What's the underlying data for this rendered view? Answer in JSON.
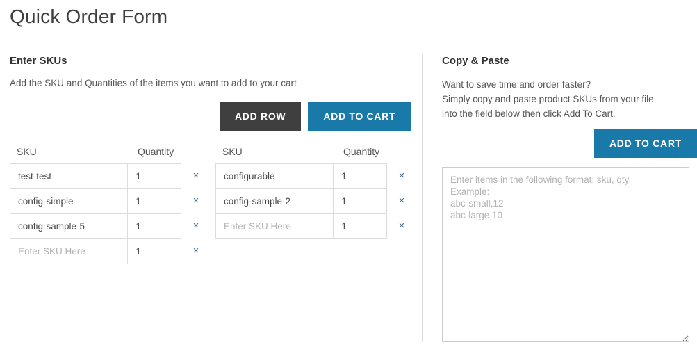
{
  "page": {
    "title": "Quick Order Form"
  },
  "colors": {
    "accent_blue": "#1979a9",
    "dark_button": "#403f3f",
    "remove_icon": "#4a6e8a",
    "border": "#dcdcdc",
    "placeholder": "#b3b3b3"
  },
  "enter_skus": {
    "heading": "Enter SKUs",
    "description": "Add the SKU and Quantities of the items you want to add to your cart",
    "add_row_label": "ADD ROW",
    "add_to_cart_label": "ADD TO CART",
    "columns": {
      "sku": "SKU",
      "quantity": "Quantity"
    },
    "sku_placeholder": "Enter SKU Here",
    "remove_icon": "close-icon",
    "remove_glyph": "×",
    "tables": [
      {
        "rows": [
          {
            "sku": "test-test",
            "qty": "1"
          },
          {
            "sku": "config-simple",
            "qty": "1"
          },
          {
            "sku": "config-sample-5",
            "qty": "1"
          },
          {
            "sku": "",
            "qty": "1"
          }
        ]
      },
      {
        "rows": [
          {
            "sku": "configurable",
            "qty": "1"
          },
          {
            "sku": "config-sample-2",
            "qty": "1"
          },
          {
            "sku": "",
            "qty": "1"
          }
        ]
      }
    ]
  },
  "copy_paste": {
    "heading": "Copy & Paste",
    "description_line_1": "Want to save time and order faster?",
    "description_line_2": "Simply copy and paste product SKUs from your file",
    "description_line_3": "into the field below then click Add To Cart.",
    "add_to_cart_label": "ADD TO CART",
    "textarea_value": "",
    "textarea_placeholder": "Enter items in the following format: sku, qty\nExample:\nabc-small,12\nabc-large,10"
  }
}
